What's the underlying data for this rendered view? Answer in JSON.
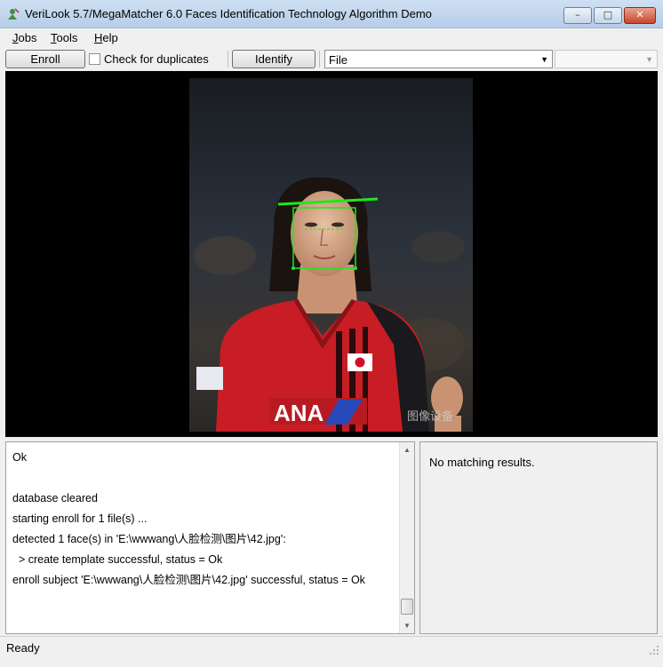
{
  "window": {
    "title": "VeriLook 5.7/MegaMatcher 6.0 Faces Identification Technology Algorithm Demo",
    "icon": "person-icon"
  },
  "menu": {
    "jobs": {
      "hotkey": "J",
      "rest": "obs"
    },
    "tools": {
      "hotkey": "T",
      "rest": "ools"
    },
    "help": {
      "hotkey": "H",
      "rest": "elp"
    }
  },
  "toolbar": {
    "enroll_label": "Enroll",
    "check_duplicates_label": "Check for duplicates",
    "check_duplicates_checked": false,
    "identify_label": "Identify",
    "source_value": "File"
  },
  "image": {
    "watermark": "图像设备"
  },
  "log": {
    "lines": [
      "Ok",
      "",
      "database cleared",
      "starting enroll for 1 file(s) ...",
      "detected 1 face(s) in 'E:\\wwwang\\人脸检测\\图片\\42.jpg':",
      "  > create template successful, status = Ok",
      "enroll subject 'E:\\wwwang\\人脸检测\\图片\\42.jpg' successful, status = Ok"
    ]
  },
  "results": {
    "text": "No matching results."
  },
  "status": {
    "text": "Ready"
  },
  "colors": {
    "face_box": "#1ee81e",
    "jersey_red": "#c81d25",
    "titlebar": "#c4d8ef"
  }
}
